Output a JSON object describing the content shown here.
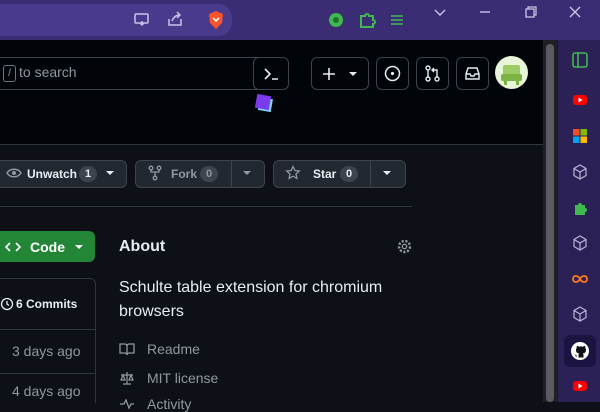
{
  "browser": {
    "toolbar_icons": [
      "cast-icon",
      "share-icon",
      "brave-shield-icon",
      "extension-gear-icon",
      "puzzle-icon",
      "menu-icon"
    ],
    "window_controls": [
      "minimize-icon",
      "restore-icon",
      "close-icon"
    ]
  },
  "header": {
    "search_hint_key": "/",
    "search_placeholder": "to search",
    "buttons": [
      "command-palette-icon",
      "plus-icon",
      "issues-icon",
      "pull-requests-icon",
      "inbox-icon",
      "avatar"
    ]
  },
  "repo_actions": {
    "watch_label": "Watch",
    "unwatch_label": "Unwatch",
    "watch_count": "1",
    "fork_label": "Fork",
    "fork_count": "0",
    "star_label": "Star",
    "star_count": "0"
  },
  "code_button": {
    "label": "Code"
  },
  "commits": {
    "label": "6 Commits",
    "rows": [
      "3 days ago",
      "4 days ago"
    ]
  },
  "about": {
    "heading": "About",
    "description": "Schulte table extension for chromium browsers",
    "readme": "Readme",
    "license": "MIT license",
    "activity": "Activity"
  },
  "colors": {
    "accent_green": "#238636",
    "chrome_purple": "#3b2d73",
    "sidebar_purple": "#2c2157"
  }
}
